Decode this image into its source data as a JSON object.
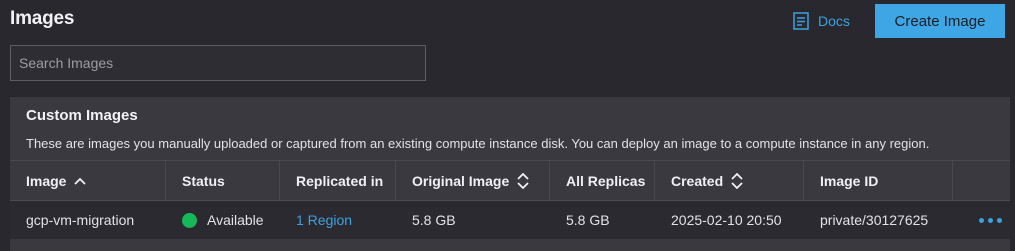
{
  "header": {
    "title": "Images",
    "docs_label": "Docs",
    "create_label": "Create Image"
  },
  "search": {
    "placeholder": "Search Images",
    "value": ""
  },
  "custom_images": {
    "title": "Custom Images",
    "description": "These are images you manually uploaded or captured from an existing compute instance disk. You can deploy an image to a compute instance in any region.",
    "columns": [
      "Image",
      "Status",
      "Replicated in",
      "Original Image",
      "All Replicas",
      "Created",
      "Image ID"
    ],
    "sort_icons": {
      "image": "chevron-up-icon",
      "original_image": "sort-icon",
      "created": "sort-icon"
    },
    "rows": [
      {
        "image": "gcp-vm-migration",
        "status": "Available",
        "replicated_in": "1 Region",
        "original_image": "5.8 GB",
        "all_replicas": "5.8 GB",
        "created": "2025-02-10 20:50",
        "image_id": "private/30127625"
      }
    ]
  },
  "colors": {
    "background": "#29282e",
    "panel": "#3a3940",
    "accent": "#3ea6e4",
    "link": "#3aa2e0",
    "status_available": "#16b85a"
  }
}
